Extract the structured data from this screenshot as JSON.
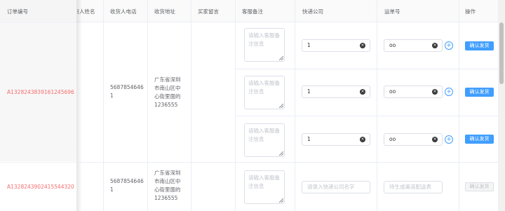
{
  "header": {
    "order_no": "订单编号",
    "receiver_name": "收货人姓名",
    "receiver_phone": "收货人电话",
    "receiver_address": "收货地址",
    "buyer_message": "买家留言",
    "service_note": "客服备注",
    "courier_company": "快递公司",
    "tracking_no": "运单号",
    "action": "操作"
  },
  "orders": [
    {
      "order_no": "A1328243839161245696",
      "phone_line1": "5687854646",
      "phone_line2": "1",
      "address_lines": [
        "广东省深圳",
        "市南山区中",
        "心街里面的",
        "1236555"
      ],
      "shipments": [
        {
          "note_placeholder_lines": [
            "请输入客服备",
            "注信息"
          ],
          "courier": "1",
          "tracking": "oo",
          "ship_label": "确认发货"
        },
        {
          "note_placeholder_lines": [
            "请输入客服备",
            "注信息"
          ],
          "courier": "1",
          "tracking": "oo",
          "ship_label": "确认发货"
        },
        {
          "note_placeholder_lines": [
            "请输入客服备",
            "注信息"
          ],
          "courier": "1",
          "tracking": "oo",
          "ship_label": "确认发货"
        }
      ]
    },
    {
      "order_no": "A1328243902415544320",
      "phone_line1": "5687854646",
      "phone_line2": "1",
      "address_lines": [
        "广东省深圳",
        "市南山区中",
        "心街里面的",
        "1236555"
      ],
      "shipments": [
        {
          "note_placeholder_lines": [
            "请输入客服备",
            "注信息"
          ],
          "courier_placeholder": "请录入快递公司名字",
          "tracking_placeholder": "待生成渠道配送表",
          "ship_label": "确认发货"
        }
      ]
    }
  ],
  "icons": {
    "clear": "close-circle-icon",
    "add": "plus-circle-icon"
  },
  "colors": {
    "primary": "#409eff",
    "order_no": "#f56c6c"
  }
}
